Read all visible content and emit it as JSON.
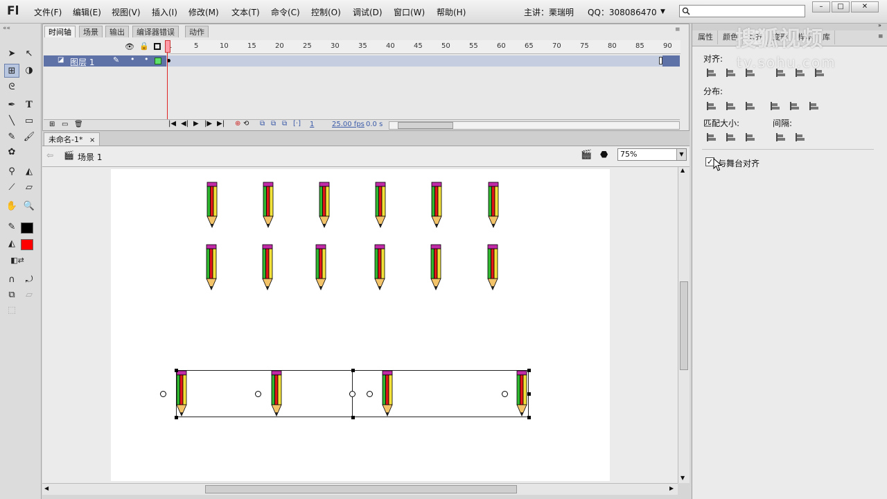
{
  "app": {
    "logo": "Fl"
  },
  "menu": [
    "文件(F)",
    "编辑(E)",
    "视图(V)",
    "插入(I)",
    "修改(M)",
    "文本(T)",
    "命令(C)",
    "控制(O)",
    "调试(D)",
    "窗口(W)",
    "帮助(H)"
  ],
  "host_info": "主讲：栗瑞明",
  "qq_info": "QQ：308086470",
  "window_buttons": [
    "–",
    "□",
    "✕"
  ],
  "timeline": {
    "tabs": [
      "时间轴",
      "场景",
      "输出",
      "编译器错误",
      "动作"
    ],
    "layer_name": "图层 1",
    "frame_numbers": [
      "1",
      "5",
      "10",
      "15",
      "20",
      "25",
      "30",
      "35",
      "40",
      "45",
      "50",
      "55",
      "60",
      "65",
      "70",
      "75",
      "80",
      "85",
      "90"
    ],
    "current_frame": "1",
    "fps": "25.00 fps",
    "time": "0.0 s"
  },
  "document": {
    "tab_title": "未命名-1*",
    "tab_close": "×",
    "scene_label": "场景 1",
    "zoom": "75%"
  },
  "align_panel": {
    "tabs": [
      "属性",
      "颜色",
      "对齐",
      "变形",
      "样本",
      "库"
    ],
    "align_label": "对齐:",
    "distribute_label": "分布:",
    "match_size_label": "匹配大小:",
    "spacing_label": "间隔:",
    "stage_align_label": "与舞台对齐",
    "stage_align_checked": true
  },
  "watermark": {
    "brand": "搜狐视频",
    "url": "tv.sohu.com"
  },
  "colors": {
    "accent_layer": "#5e72a8",
    "fill_color": "#ff0000",
    "stroke_color": "#000000"
  }
}
